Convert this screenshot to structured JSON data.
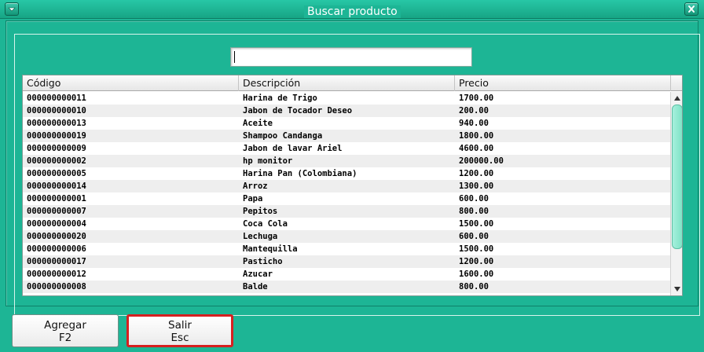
{
  "window": {
    "menu_icon": "chevron-down-icon",
    "close_icon": "close-icon"
  },
  "search": {
    "legend": "Buscar producto",
    "value": "",
    "placeholder": ""
  },
  "table": {
    "columns": [
      "Código",
      "Descripción",
      "Precio"
    ],
    "rows": [
      {
        "codigo": "000000000011",
        "descripcion": "Harina de Trigo",
        "precio": "1700.00"
      },
      {
        "codigo": "000000000010",
        "descripcion": "Jabon de Tocador Deseo",
        "precio": "200.00"
      },
      {
        "codigo": "000000000013",
        "descripcion": "Aceite",
        "precio": "940.00"
      },
      {
        "codigo": "000000000019",
        "descripcion": "Shampoo Candanga",
        "precio": "1800.00"
      },
      {
        "codigo": "000000000009",
        "descripcion": "Jabon de lavar Ariel",
        "precio": "4600.00"
      },
      {
        "codigo": "000000000002",
        "descripcion": "hp monitor",
        "precio": "200000.00"
      },
      {
        "codigo": "000000000005",
        "descripcion": "Harina Pan (Colombiana)",
        "precio": "1200.00"
      },
      {
        "codigo": "000000000014",
        "descripcion": "Arroz",
        "precio": "1300.00"
      },
      {
        "codigo": "000000000001",
        "descripcion": "Papa",
        "precio": "600.00"
      },
      {
        "codigo": "000000000007",
        "descripcion": "Pepitos",
        "precio": "800.00"
      },
      {
        "codigo": "000000000004",
        "descripcion": "Coca Cola",
        "precio": "1500.00"
      },
      {
        "codigo": "000000000020",
        "descripcion": "Lechuga",
        "precio": "600.00"
      },
      {
        "codigo": "000000000006",
        "descripcion": "Mantequilla",
        "precio": "1500.00"
      },
      {
        "codigo": "000000000017",
        "descripcion": "Pasticho",
        "precio": "1200.00"
      },
      {
        "codigo": "000000000012",
        "descripcion": "Azucar",
        "precio": "1600.00"
      },
      {
        "codigo": "000000000008",
        "descripcion": "Balde",
        "precio": "800.00"
      }
    ]
  },
  "buttons": {
    "agregar_label": "Agregar",
    "agregar_key": "F2",
    "salir_label": "Salir",
    "salir_key": "Esc"
  },
  "colors": {
    "background": "#1db595",
    "highlight_border": "#d62020",
    "scroll_thumb": "#8ee8cf"
  }
}
